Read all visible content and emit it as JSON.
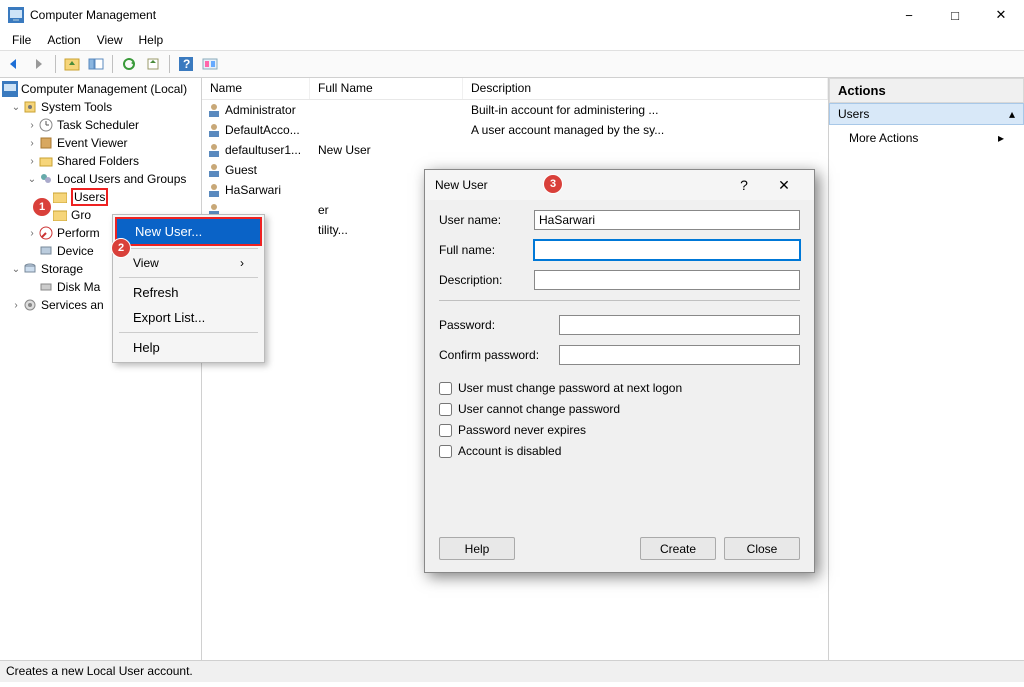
{
  "window": {
    "title": "Computer Management"
  },
  "menu": {
    "file": "File",
    "action": "Action",
    "view": "View",
    "help": "Help"
  },
  "tree": {
    "root": "Computer Management (Local)",
    "system_tools": "System Tools",
    "task_scheduler": "Task Scheduler",
    "event_viewer": "Event Viewer",
    "shared_folders": "Shared Folders",
    "local_users_groups": "Local Users and Groups",
    "users": "Users",
    "groups": "Gro",
    "performance": "Perform",
    "device_mgr": "Device",
    "storage": "Storage",
    "disk_mgmt": "Disk Ma",
    "services": "Services an"
  },
  "list": {
    "headers": {
      "name": "Name",
      "full": "Full Name",
      "desc": "Description"
    },
    "rows": [
      {
        "name": "Administrator",
        "full": "",
        "desc": "Built-in account for administering ..."
      },
      {
        "name": "DefaultAcco...",
        "full": "",
        "desc": "A user account managed by the sy..."
      },
      {
        "name": "defaultuser1...",
        "full": "New User",
        "desc": ""
      },
      {
        "name": "Guest",
        "full": "",
        "desc": ""
      },
      {
        "name": "HaSarwari",
        "full": "",
        "desc": ""
      },
      {
        "name": "",
        "full": "er",
        "desc": ""
      },
      {
        "name": "",
        "full": "tility...",
        "desc": ""
      }
    ]
  },
  "ctx": {
    "new_user": "New User...",
    "view": "View",
    "refresh": "Refresh",
    "export": "Export List...",
    "help": "Help"
  },
  "actions": {
    "header": "Actions",
    "users": "Users",
    "more": "More Actions"
  },
  "dialog": {
    "title": "New User",
    "username_label": "User name:",
    "username_value": "HaSarwari",
    "fullname_label": "Full name:",
    "fullname_value": "",
    "desc_label": "Description:",
    "desc_value": "",
    "password_label": "Password:",
    "confirm_label": "Confirm password:",
    "chk1": "User must change password at next logon",
    "chk2": "User cannot change password",
    "chk3": "Password never expires",
    "chk4": "Account is disabled",
    "help_btn": "Help",
    "create_btn": "Create",
    "close_btn": "Close"
  },
  "status": "Creates a new Local User account.",
  "badges": {
    "b1": "1",
    "b2": "2",
    "b3": "3"
  }
}
